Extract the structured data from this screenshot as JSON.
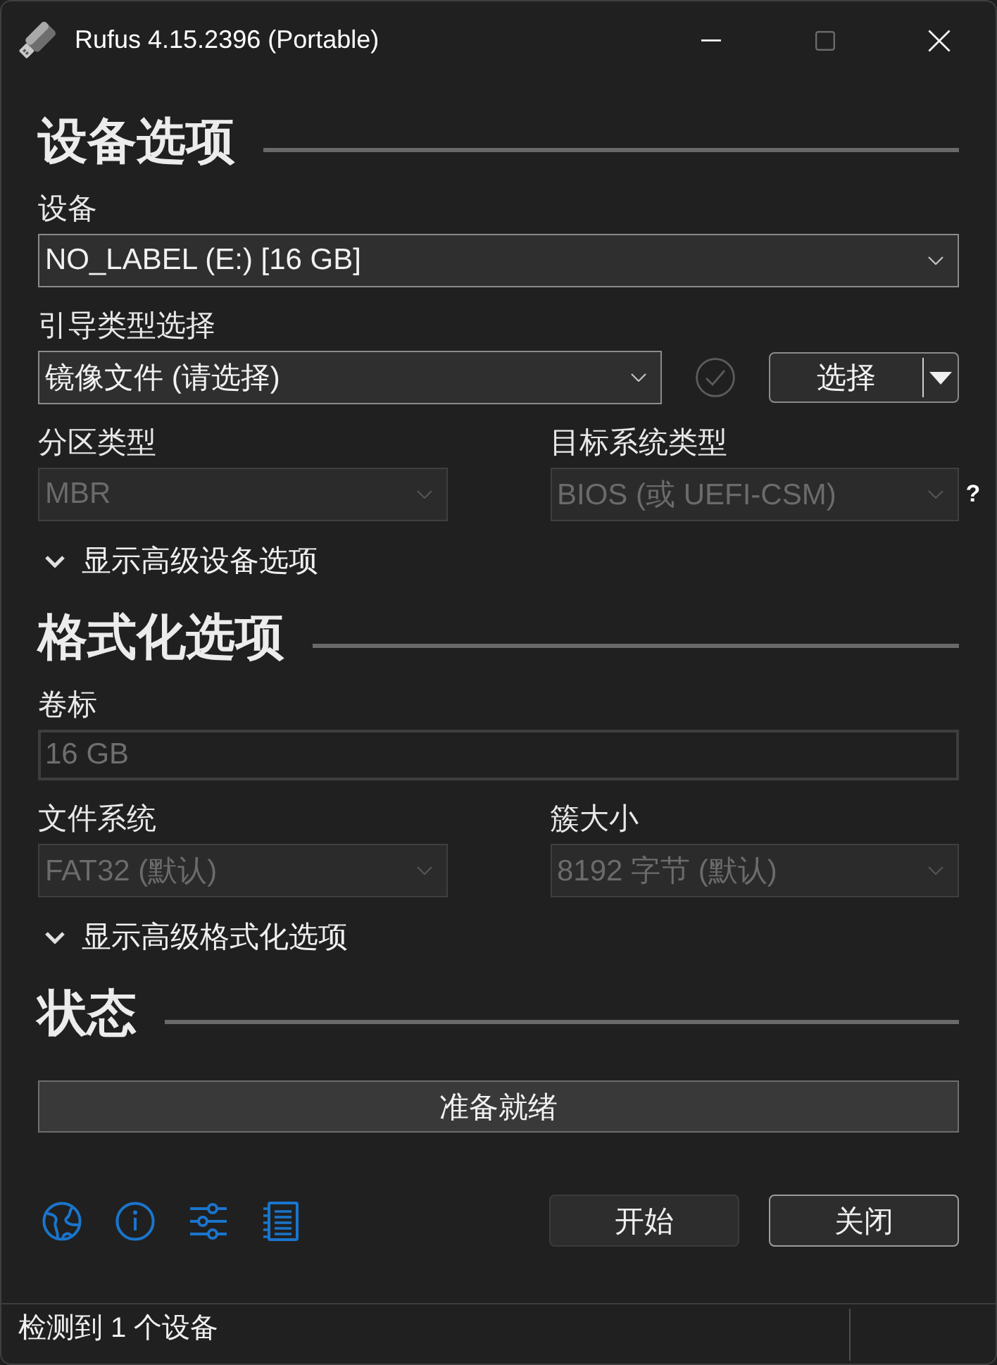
{
  "window": {
    "title": "Rufus 4.15.2396 (Portable)",
    "maximize_disabled": true
  },
  "sections": [
    {
      "heading": "设备选项",
      "rows": [
        [
          {
            "kind": "dropdown",
            "label": "设备",
            "value": "NO_LABEL (E:) [16 GB]",
            "disabled": false
          }
        ],
        [
          {
            "kind": "dropdown",
            "label": "引导类型选择",
            "value": "镜像文件 (请选择)",
            "disabled": false
          },
          {
            "kind": "verify"
          },
          {
            "kind": "split_button",
            "label": "选择",
            "disabled": false
          }
        ],
        [
          {
            "kind": "dropdown",
            "label": "分区类型",
            "value": "MBR",
            "disabled": true
          },
          {
            "kind": "dropdown",
            "label": "目标系统类型",
            "value": "BIOS (或 UEFI-CSM)",
            "disabled": true,
            "help": "?"
          }
        ]
      ],
      "expander": {
        "label": "显示高级设备选项",
        "expanded": false
      }
    },
    {
      "heading": "格式化选项",
      "rows": [
        [
          {
            "kind": "text_field",
            "label": "卷标",
            "value": "16 GB",
            "disabled": true
          }
        ],
        [
          {
            "kind": "dropdown",
            "label": "文件系统",
            "value": "FAT32 (默认)",
            "disabled": true
          },
          {
            "kind": "dropdown",
            "label": "簇大小",
            "value": "8192 字节 (默认)",
            "disabled": true
          }
        ]
      ],
      "expander": {
        "label": "显示高级格式化选项",
        "expanded": false
      }
    },
    {
      "heading": "状态",
      "status": {
        "text": "准备就绪"
      }
    }
  ],
  "buttons": [
    {
      "label": "开始",
      "focused": false
    },
    {
      "label": "关闭",
      "focused": true
    }
  ],
  "status_bar": {
    "text": "检测到 1 个设备"
  }
}
